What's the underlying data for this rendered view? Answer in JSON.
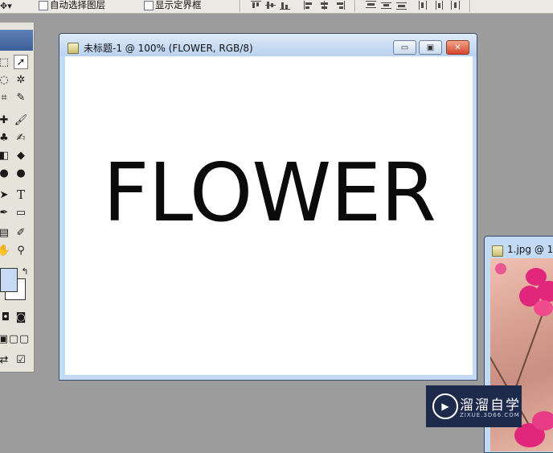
{
  "options_bar": {
    "auto_select_label": "自动选择图层",
    "show_bounds_label": "显示定界框"
  },
  "document": {
    "title": "未标题-1 @ 100% (FLOWER, RGB/8)",
    "text_layer": "FLOWER",
    "buttons": {
      "minimize": "▭",
      "restore": "▣",
      "close": "✕"
    }
  },
  "document2": {
    "title": "1.jpg @ 1"
  },
  "watermark": {
    "brand": "溜溜自学",
    "url": "ZIXUE.3D66.COM"
  },
  "colors": {
    "foreground": "#c6daf3",
    "background": "#ffffff",
    "window_frame": "#c3daf5"
  },
  "icons": {
    "move_tool": "move-icon",
    "type_tool": "type-icon",
    "zoom_tool": "zoom-icon"
  }
}
